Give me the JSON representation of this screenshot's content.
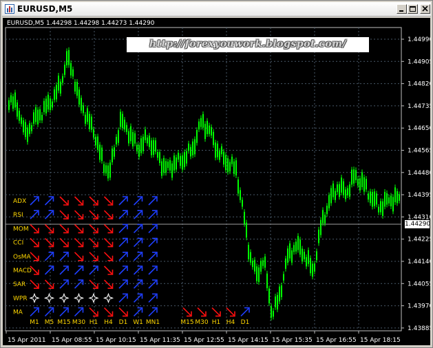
{
  "window": {
    "title": "EURUSD,M5"
  },
  "header": {
    "symbol_line": "EURUSD,M5  1.44298 1.44298 1.44273 1.44290"
  },
  "watermark": "http://forexyouwork.blogspot.com/",
  "price_axis": {
    "labels": [
      "1.44990",
      "1.44905",
      "1.44820",
      "1.44735",
      "1.44650",
      "1.44565",
      "1.44480",
      "1.44395",
      "1.44310",
      "1.44225",
      "1.44140",
      "1.44055",
      "1.43970",
      "1.43885"
    ],
    "current_price": "1.44290"
  },
  "time_axis": [
    "15 Apr 2011",
    "15 Apr 08:55",
    "15 Apr 10:15",
    "15 Apr 11:35",
    "15 Apr 12:55",
    "15 Apr 14:15",
    "15 Apr 15:35",
    "15 Apr 16:55",
    "15 Apr 18:15"
  ],
  "indicator_panel": {
    "rows": [
      {
        "name": "ADX",
        "signals": [
          "up",
          "up",
          "down",
          "down",
          "down",
          "down",
          "up",
          "up",
          "up"
        ]
      },
      {
        "name": "RSI",
        "signals": [
          "up",
          "up",
          "down",
          "down",
          "down",
          "down",
          "up",
          "up",
          "up"
        ]
      },
      {
        "name": "MOM",
        "signals": [
          "down",
          "down",
          "down",
          "down",
          "down",
          "down",
          "up",
          "up",
          "up"
        ]
      },
      {
        "name": "CCI",
        "signals": [
          "down",
          "down",
          "down",
          "down",
          "down",
          "down",
          "up",
          "up",
          "up"
        ]
      },
      {
        "name": "OsMA",
        "signals": [
          "down",
          "up",
          "up",
          "down",
          "down",
          "down",
          "up",
          "up",
          "up"
        ]
      },
      {
        "name": "MACD",
        "signals": [
          "down",
          "up",
          "up",
          "up",
          "up",
          "down",
          "up",
          "up",
          "up"
        ]
      },
      {
        "name": "SAR",
        "signals": [
          "down",
          "down",
          "up",
          "up",
          "down",
          "down",
          "up",
          "up",
          "up"
        ]
      },
      {
        "name": "WPR",
        "signals": [
          "neutral",
          "neutral",
          "neutral",
          "neutral",
          "neutral",
          "neutral",
          "up",
          "up",
          "up"
        ]
      },
      {
        "name": "MA",
        "signals": [
          "up",
          "up",
          "up",
          "up",
          "down",
          "down",
          "down",
          "up",
          "up"
        ]
      }
    ],
    "timeframes": [
      "M1",
      "M5",
      "M15",
      "M30",
      "H1",
      "H4",
      "D1",
      "W1",
      "MN1"
    ],
    "secondary": {
      "signals": [
        "down",
        "down",
        "down",
        "down",
        "up"
      ],
      "timeframes": [
        "M15",
        "M30",
        "H1",
        "H4",
        "D1"
      ]
    }
  },
  "colors": {
    "background": "#000000",
    "candles": "#00ff00",
    "grid": "#4a5a6a",
    "up_arrow": "#1f3fff",
    "down_arrow": "#ff1010",
    "indicator_label": "#ffd700",
    "neutral": "#ffffff"
  }
}
